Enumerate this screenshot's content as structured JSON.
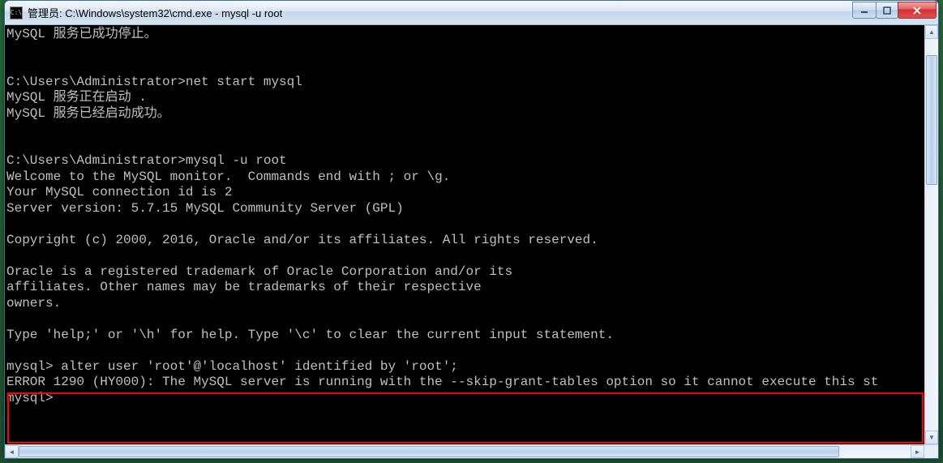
{
  "window": {
    "title": "管理员: C:\\Windows\\system32\\cmd.exe - mysql  -u root",
    "icon_glyph": "C:\\"
  },
  "terminal": {
    "lines": [
      "MySQL 服务已成功停止。",
      "",
      "",
      "C:\\Users\\Administrator>net start mysql",
      "MySQL 服务正在启动 .",
      "MySQL 服务已经启动成功。",
      "",
      "",
      "C:\\Users\\Administrator>mysql -u root",
      "Welcome to the MySQL monitor.  Commands end with ; or \\g.",
      "Your MySQL connection id is 2",
      "Server version: 5.7.15 MySQL Community Server (GPL)",
      "",
      "Copyright (c) 2000, 2016, Oracle and/or its affiliates. All rights reserved.",
      "",
      "Oracle is a registered trademark of Oracle Corporation and/or its",
      "affiliates. Other names may be trademarks of their respective",
      "owners.",
      "",
      "Type 'help;' or '\\h' for help. Type '\\c' to clear the current input statement.",
      "",
      "mysql> alter user 'root'@'localhost' identified by 'root';",
      "ERROR 1290 (HY000): The MySQL server is running with the --skip-grant-tables option so it cannot execute this st",
      "mysql>",
      "",
      ""
    ]
  }
}
